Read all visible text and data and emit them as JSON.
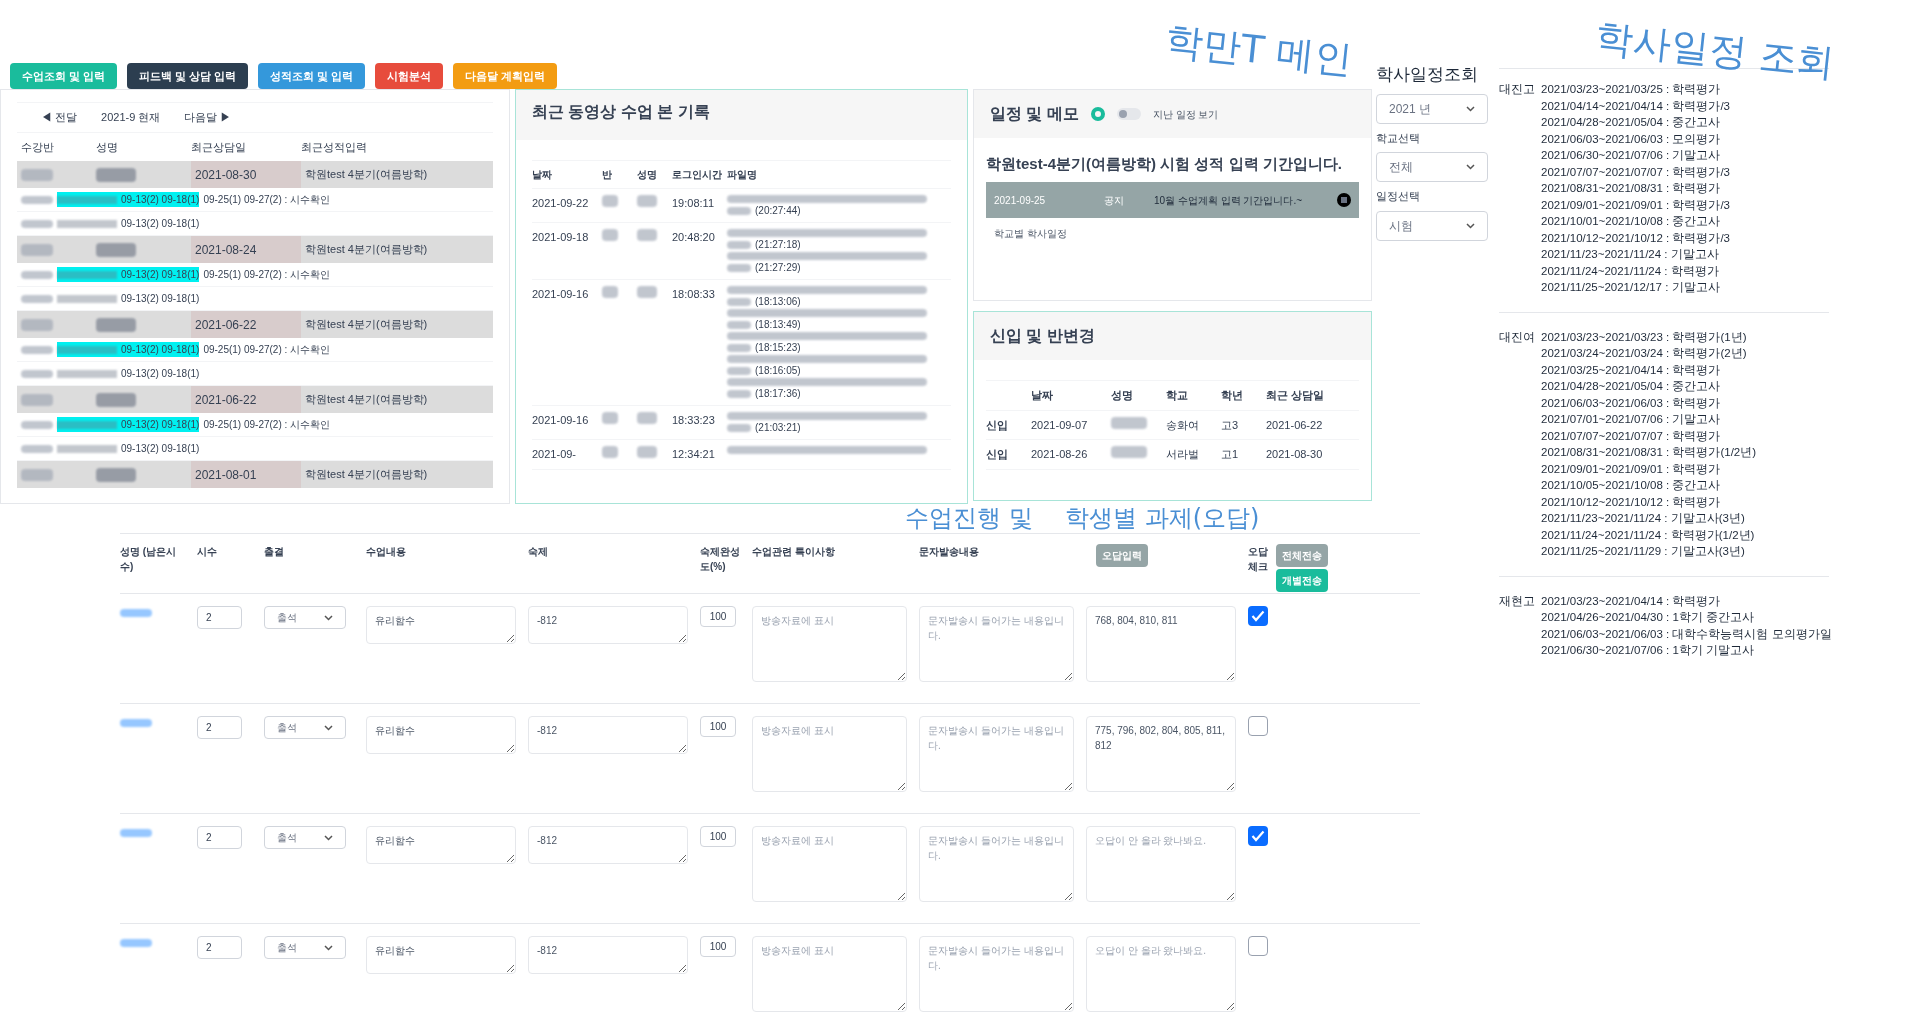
{
  "annotations": [
    {
      "text": "학만T 메인"
    },
    {
      "text": "학사일정 조회"
    },
    {
      "text": "수업진행 및"
    },
    {
      "text": "학생별 과제(오답)"
    }
  ],
  "nav_buttons": [
    {
      "label": "수업조회 및 입력",
      "color": "#1abc9c"
    },
    {
      "label": "피드백 및 상담 입력",
      "color": "#2c3e50"
    },
    {
      "label": "성적조회 및 입력",
      "color": "#3498db"
    },
    {
      "label": "시험분석",
      "color": "#e74c3c"
    },
    {
      "label": "다음달 계획입력",
      "color": "#f39c12"
    }
  ],
  "student_panel": {
    "month_nav": {
      "prev": "◀ 전달",
      "current": "2021-9 현재",
      "next": "다음달 ▶"
    },
    "columns": [
      "수강반",
      "성명",
      "최근상담일",
      "최근성적입력"
    ],
    "rows": [
      {
        "date": "2021-08-30",
        "grade": "학원test 4분기(여름방학)",
        "lines": [
          {
            "highlighted": true,
            "marked": "09-13(2) 09-18(1)",
            "rest": "09-25(1) 09-27(2) : 시수확인"
          },
          {
            "highlighted": false,
            "marked": "09-13(2) 09-18(1)"
          }
        ]
      },
      {
        "date": "2021-08-24",
        "grade": "학원test 4분기(여름방학)",
        "lines": [
          {
            "highlighted": true,
            "marked": "09-13(2) 09-18(1)",
            "rest": "09-25(1) 09-27(2) : 시수확인"
          },
          {
            "highlighted": false,
            "marked": "09-13(2) 09-18(1)"
          }
        ]
      },
      {
        "date": "2021-06-22",
        "grade": "학원test 4분기(여름방학)",
        "lines": [
          {
            "highlighted": true,
            "marked": "09-13(2) 09-18(1)",
            "rest": "09-25(1) 09-27(2) : 시수확인"
          },
          {
            "highlighted": false,
            "marked": "09-13(2) 09-18(1)"
          }
        ]
      },
      {
        "date": "2021-06-22",
        "grade": "학원test 4분기(여름방학)",
        "lines": [
          {
            "highlighted": true,
            "marked": "09-13(2) 09-18(1)",
            "rest": "09-25(1) 09-27(2) : 시수확인"
          },
          {
            "highlighted": false,
            "marked": "09-13(2) 09-18(1)"
          }
        ]
      },
      {
        "date": "2021-08-01",
        "grade": "학원test 4분기(여름방학)"
      }
    ]
  },
  "video_panel": {
    "title": "최근 동영상 수업 본 기록",
    "columns": [
      "날짜",
      "반",
      "성명",
      "로그인시간",
      "파일명"
    ],
    "rows": [
      {
        "date": "2021-09-22",
        "time": "19:08:11",
        "files": [
          {
            "time": "(20:27:44)"
          }
        ]
      },
      {
        "date": "2021-09-18",
        "time": "20:48:20",
        "files": [
          {
            "time": "(21:27:18)"
          },
          {
            "time": "(21:27:29)"
          }
        ]
      },
      {
        "date": "2021-09-16",
        "time": "18:08:33",
        "files": [
          {
            "time": "(18:13:06)"
          },
          {
            "time": "(18:13:49)"
          },
          {
            "time": "(18:15:23)"
          },
          {
            "time": "(18:16:05)"
          },
          {
            "time": "(18:17:36)"
          }
        ]
      },
      {
        "date": "2021-09-16",
        "time": "18:33:23",
        "files": [
          {
            "time": "(21:03:21)"
          }
        ]
      },
      {
        "date": "2021-09-",
        "time": "12:34:21"
      }
    ]
  },
  "memo_panel": {
    "title": "일정 및 메모",
    "toggle": {
      "label": "지난 일정 보기",
      "on": false
    },
    "notice_title": "학원test-4분기(여름방학) 시험 성적 입력 기간입니다.",
    "notice": {
      "date": "2021-09-25",
      "type": "공지",
      "text": "10월 수업계획 입력 기간입니다.~"
    },
    "link": "학교별 학사일정"
  },
  "change_panel": {
    "title": "신입 및 반변경",
    "columns": [
      "날짜",
      "성명",
      "학교",
      "학년",
      "최근 상담일"
    ],
    "rows": [
      {
        "type": "신입",
        "date": "2021-09-07",
        "school": "송화여",
        "grade": "고3",
        "recent": "2021-06-22"
      },
      {
        "type": "신입",
        "date": "2021-08-26",
        "school": "서라벌",
        "grade": "고1",
        "recent": "2021-08-30"
      }
    ]
  },
  "schedule": {
    "title": "학사일정조회",
    "year": "2021 년",
    "school_label": "학교선택",
    "school": "전체",
    "type_label": "일정선택",
    "type": "시험",
    "schools": [
      {
        "name": "대진고",
        "entries": [
          "2021/03/23~2021/03/25 : 학력평가",
          "2021/04/14~2021/04/14 : 학력평가/3",
          "2021/04/28~2021/05/04 : 중간고사",
          "2021/06/03~2021/06/03 : 모의평가",
          "2021/06/30~2021/07/06 : 기말고사",
          "2021/07/07~2021/07/07 : 학력평가/3",
          "2021/08/31~2021/08/31 : 학력평가",
          "2021/09/01~2021/09/01 : 학력평가/3",
          "2021/10/01~2021/10/08 : 중간고사",
          "2021/10/12~2021/10/12 : 학력평가/3",
          "2021/11/23~2021/11/24 : 기말고사",
          "2021/11/24~2021/11/24 : 학력평가",
          "2021/11/25~2021/12/17 : 기말고사"
        ]
      },
      {
        "name": "대진여",
        "entries": [
          "2021/03/23~2021/03/23 : 학력평가(1년)",
          "2021/03/24~2021/03/24 : 학력평가(2년)",
          "2021/03/25~2021/04/14 : 학력평가",
          "2021/04/28~2021/05/04 : 중간고사",
          "2021/06/03~2021/06/03 : 학력평가",
          "2021/07/01~2021/07/06 : 기말고사",
          "2021/07/07~2021/07/07 : 학력평가",
          "2021/08/31~2021/08/31 : 학력평가(1/2년)",
          "2021/09/01~2021/09/01 : 학력평가",
          "2021/10/05~2021/10/08 : 중간고사",
          "2021/10/12~2021/10/12 : 학력평가",
          "2021/11/23~2021/11/24 : 기말고사(3년)",
          "2021/11/24~2021/11/24 : 학력평가(1/2년)",
          "2021/11/25~2021/11/29 : 기말고사(3년)"
        ]
      },
      {
        "name": "재현고",
        "entries": [
          "2021/03/23~2021/04/14 : 학력평가",
          "2021/04/26~2021/04/30 : 1학기 중간고사",
          "2021/06/03~2021/06/03 : 대학수학능력시험 모의평가일",
          "2021/06/30~2021/07/06 : 1학기 기말고사"
        ]
      }
    ]
  },
  "lesson_table": {
    "columns": [
      "성명 (남은시수)",
      "시수",
      "출결",
      "수업내용",
      "숙제",
      "숙제완성도(%)",
      "수업관련 특이사항",
      "문자발송내용"
    ],
    "wrong_input_button": "오답입력",
    "check_header": "오답 체크",
    "send_all": "전체전송",
    "send_each": "개별전송",
    "rows": [
      {
        "hours": "2",
        "attendance": "출석",
        "content": "유리함수",
        "homework": "-812",
        "completion": "100",
        "notes_placeholder": "방송자료에 표시",
        "sms_placeholder": "문자발송시 들어가는 내용입니다.",
        "wrong": {
          "value": "768, 804, 810, 811"
        },
        "checked": true
      },
      {
        "hours": "2",
        "attendance": "출석",
        "content": "유리함수",
        "homework": "-812",
        "completion": "100",
        "notes_placeholder": "방송자료에 표시",
        "sms_placeholder": "문자발송시 들어가는 내용입니다.",
        "wrong": {
          "value": "775, 796, 802, 804, 805, 811, 812"
        },
        "checked": false
      },
      {
        "hours": "2",
        "attendance": "출석",
        "content": "유리함수",
        "homework": "-812",
        "completion": "100",
        "notes_placeholder": "방송자료에 표시",
        "sms_placeholder": "문자발송시 들어가는 내용입니다.",
        "wrong": {
          "placeholder": "오답이 안 올라 왔나봐요."
        },
        "checked": true
      },
      {
        "hours": "2",
        "attendance": "출석",
        "content": "유리함수",
        "homework": "-812",
        "completion": "100",
        "notes_placeholder": "방송자료에 표시",
        "sms_placeholder": "문자발송시 들어가는 내용입니다.",
        "wrong": {
          "placeholder": "오답이 안 올라 왔나봐요."
        },
        "checked": false
      }
    ]
  }
}
